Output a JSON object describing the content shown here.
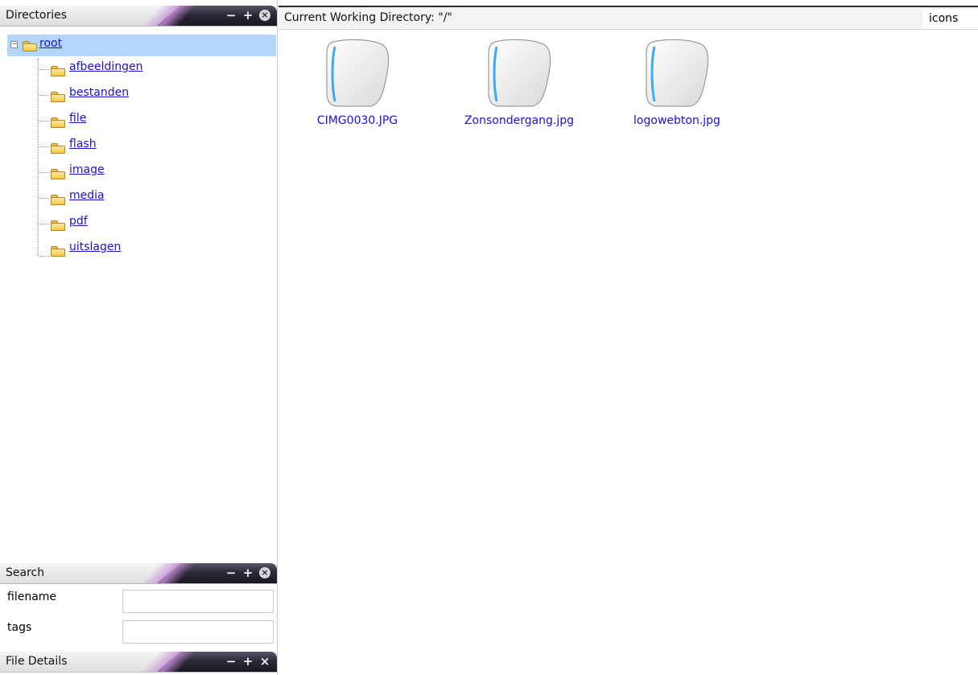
{
  "directories_panel": {
    "title": "Directories",
    "root": {
      "label": "root"
    },
    "children": [
      {
        "label": "afbeeldingen"
      },
      {
        "label": "bestanden"
      },
      {
        "label": "file"
      },
      {
        "label": "flash"
      },
      {
        "label": "image"
      },
      {
        "label": "media"
      },
      {
        "label": "pdf"
      },
      {
        "label": "uitslagen"
      }
    ]
  },
  "search_panel": {
    "title": "Search",
    "filename_label": "filename",
    "filename_value": "",
    "tags_label": "tags",
    "tags_value": ""
  },
  "file_details_panel": {
    "title": "File Details"
  },
  "controls": {
    "minimize": "−",
    "maximize": "+",
    "close": "×"
  },
  "main": {
    "cwd_label": "Current Working Directory: \"/\"",
    "view_mode": "icons",
    "files": [
      {
        "name": "CIMG0030.JPG",
        "icon": "image-file-icon"
      },
      {
        "name": "Zonsondergang.jpg",
        "icon": "image-file-icon"
      },
      {
        "name": "logowebton.jpg",
        "icon": "image-file-icon"
      }
    ]
  },
  "colors": {
    "link": "#1a10d8",
    "selection": "#b3d6ff",
    "header_dark": "#2b2736"
  }
}
